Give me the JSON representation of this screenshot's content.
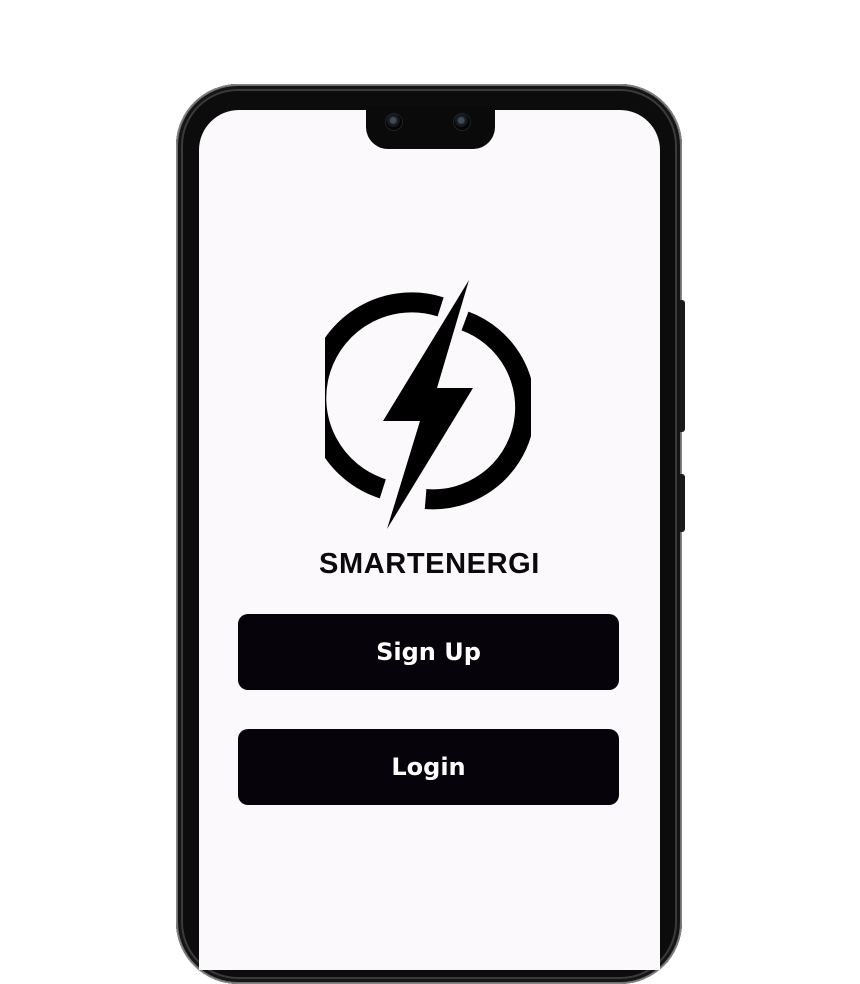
{
  "app": {
    "brand_name": "SMARTENERGI",
    "logo_icon": "lightning-power-icon"
  },
  "actions": {
    "signup_label": "Sign Up",
    "login_label": "Login"
  },
  "colors": {
    "screen_background": "#fcf9fc",
    "button_background": "#07030a",
    "button_text": "#ffffff",
    "brand_text": "#0a0a0a"
  }
}
